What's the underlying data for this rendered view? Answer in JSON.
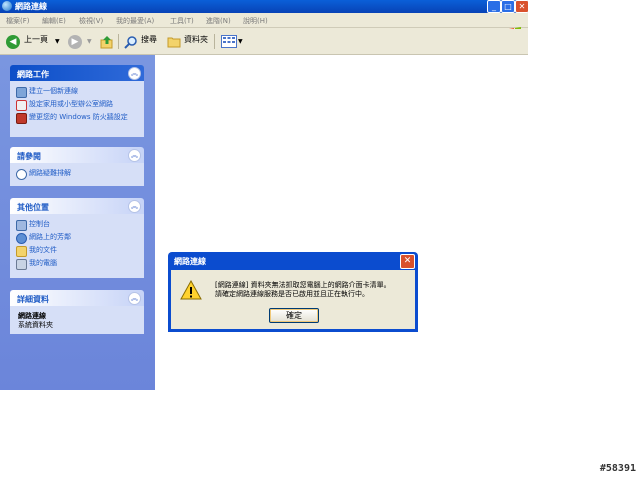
{
  "window": {
    "title": "網路連線",
    "minimize_glyph": "_",
    "maximize_glyph": "□",
    "close_glyph": "✕"
  },
  "menu": [
    "檔案(F)",
    "編輯(E)",
    "檢視(V)",
    "我的最愛(A)",
    "工具(T)",
    "進階(N)",
    "說明(H)"
  ],
  "toolbar": {
    "back_label": "上一頁",
    "search_label": "搜尋",
    "folders_label": "資料夾"
  },
  "taskpane": {
    "network_tasks": {
      "title": "網路工作",
      "items": [
        "建立一個新連線",
        "設定家用或小型辦公室網路",
        "變更您的 Windows 防火牆設定"
      ]
    },
    "see_also": {
      "title": "請參閱",
      "items": [
        "網路疑難排解"
      ]
    },
    "other_places": {
      "title": "其他位置",
      "items": [
        "控制台",
        "網路上的芳鄰",
        "我的文件",
        "我的電腦"
      ]
    },
    "details": {
      "title": "詳細資料",
      "name": "網路連線",
      "type": "系統資料夾"
    },
    "collapse_glyph": "︽"
  },
  "dialog": {
    "title": "網路連線",
    "message_line1": "[網路連線] 資料夾無法抓取您電腦上的網路介面卡清單。",
    "message_line2": "請確定網路連線服務是否已啟用並且正在執行中。",
    "ok_label": "確定",
    "close_glyph": "✕"
  },
  "watermark": "#58391",
  "colors": {
    "title_blue": "#0a5fd8",
    "taskpane_blue": "#7a96e0",
    "link_blue": "#215dc6",
    "close_red": "#d9512c"
  }
}
